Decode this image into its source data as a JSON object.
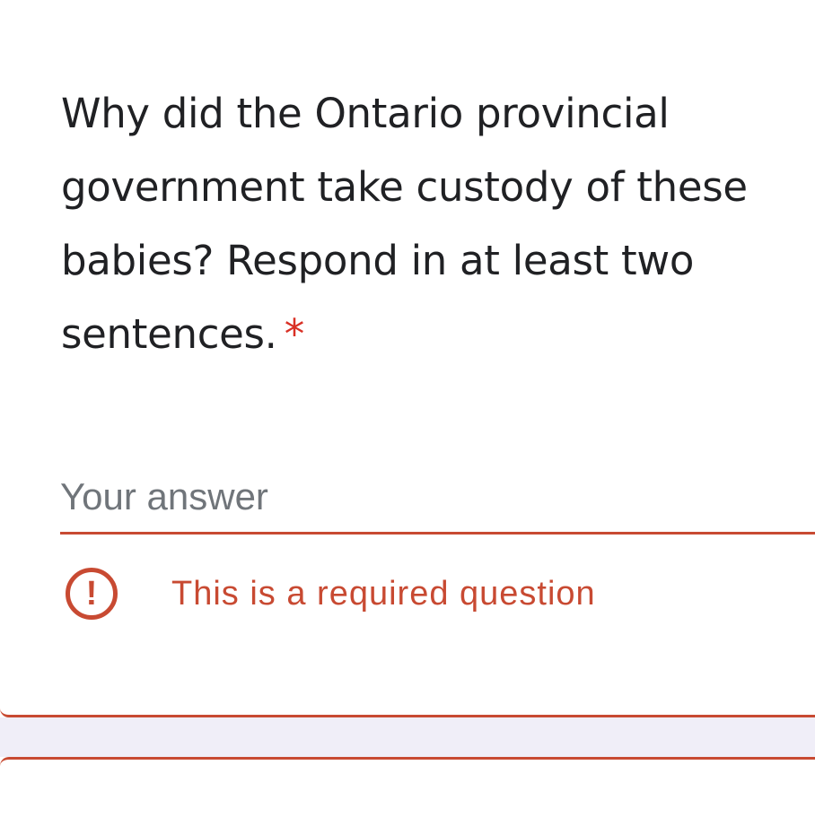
{
  "question": {
    "text": "Why did the Ontario provincial government take custody of these babies? Respond in at least two sentences.",
    "required_marker": "*"
  },
  "answer": {
    "placeholder": "Your answer",
    "value": ""
  },
  "error": {
    "icon": "exclamation-circle-icon",
    "icon_glyph": "!",
    "message": "This is a required question"
  },
  "colors": {
    "error": "#c84a32",
    "question_text": "#202124",
    "placeholder": "#70757a",
    "form_background": "#f0eef8"
  }
}
